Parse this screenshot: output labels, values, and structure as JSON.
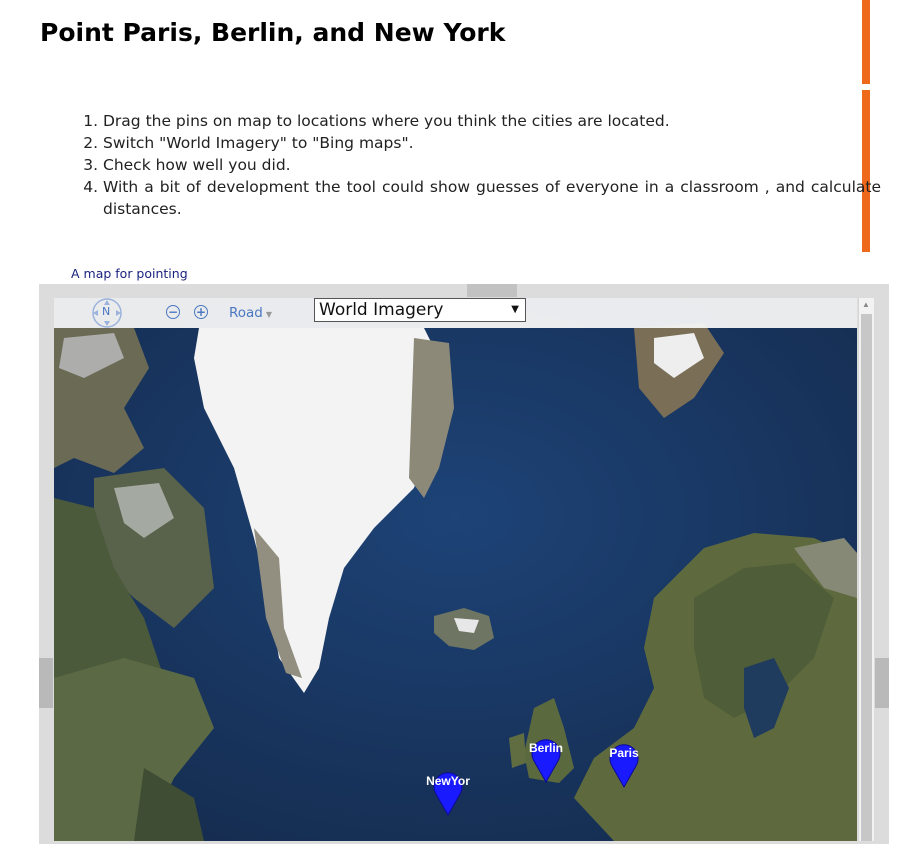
{
  "page": {
    "title": "Point Paris, Berlin, and New York",
    "instructions": [
      "Drag the pins on map to locations where you think the cities are located.",
      "Switch \"World Imagery\" to \"Bing maps\".",
      "Check how well you did.",
      "With a bit of development the tool could show guesses of everyone in a classroom , and calculate distances."
    ],
    "map_caption": "A map for pointing"
  },
  "map": {
    "compass_label": "N",
    "zoom_out_symbol": "−",
    "zoom_in_symbol": "+",
    "road_label": "Road",
    "layer_select_value": "World Imagery",
    "pins": [
      {
        "label": "NewYor",
        "color": "#1a1aff"
      },
      {
        "label": "Berlin",
        "color": "#1a1aff"
      },
      {
        "label": "Paris",
        "color": "#1a1aff"
      }
    ]
  },
  "colors": {
    "accent": "#ee6a1a",
    "link": "#4a78c2",
    "ocean": "#1c3a61",
    "pin": "#1a1aff"
  },
  "icons": [
    "compass-icon",
    "zoom-out-icon",
    "zoom-in-icon",
    "map-pin-icon",
    "dropdown-arrow-icon"
  ]
}
